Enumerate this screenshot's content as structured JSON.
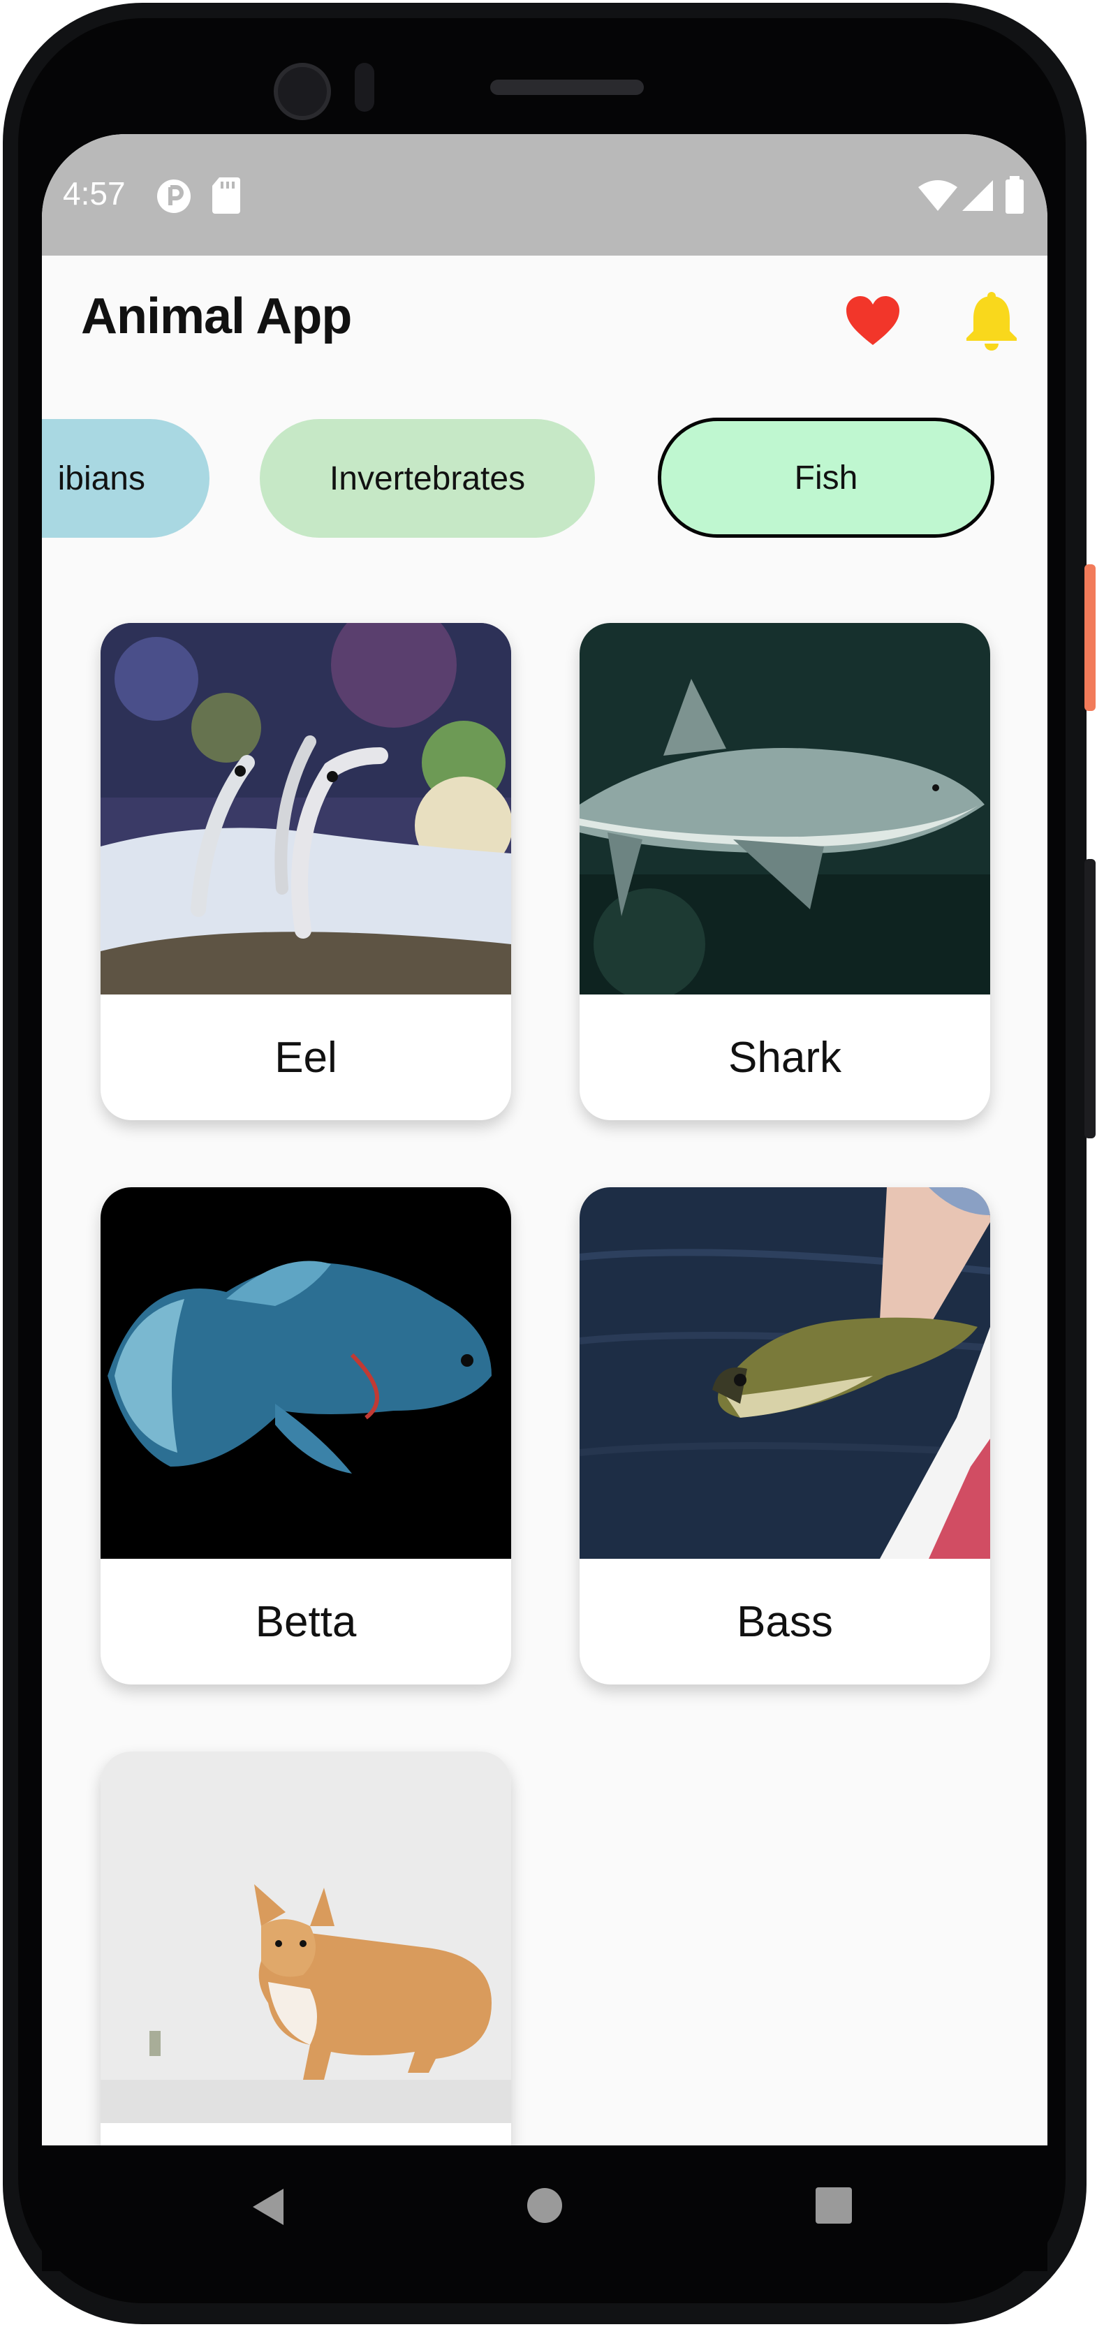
{
  "status_bar": {
    "time": "4:57"
  },
  "header": {
    "title": "Animal App"
  },
  "icons": {
    "favorites": "heart-icon",
    "notifications": "bell-icon",
    "heart_color": "#f2362a",
    "bell_color": "#f9d81c"
  },
  "categories": [
    {
      "label": "ibians",
      "color": "#a9d8e2",
      "selected": false
    },
    {
      "label": "Invertebrates",
      "color": "#c6e8c6",
      "selected": false
    },
    {
      "label": "Fish",
      "color": "#bff7d0",
      "selected": true
    }
  ],
  "animals": [
    {
      "name": "Eel"
    },
    {
      "name": "Shark"
    },
    {
      "name": "Betta"
    },
    {
      "name": "Bass"
    },
    {
      "name": ""
    }
  ]
}
